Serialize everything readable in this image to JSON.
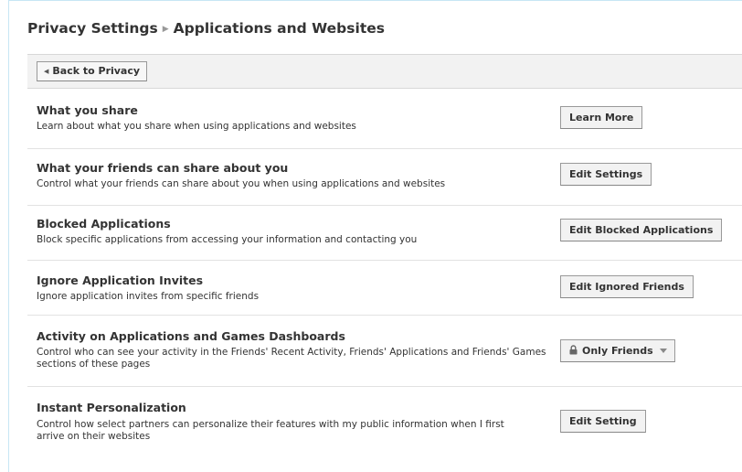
{
  "breadcrumb": {
    "root": "Privacy Settings",
    "current": "Applications and Websites"
  },
  "toolbar": {
    "back_label": "Back to Privacy"
  },
  "sections": [
    {
      "title": "What you share",
      "description": "Learn about what you share when using applications and websites",
      "button": "Learn More"
    },
    {
      "title": "What your friends can share about you",
      "description": "Control what your friends can share about you when using applications and websites",
      "button": "Edit Settings"
    },
    {
      "title": "Blocked Applications",
      "description": "Block specific applications from accessing your information and contacting you",
      "button": "Edit Blocked Applications"
    },
    {
      "title": "Ignore Application Invites",
      "description": "Ignore application invites from specific friends",
      "button": "Edit Ignored Friends"
    },
    {
      "title": "Activity on Applications and Games Dashboards",
      "description": "Control who can see your activity in the Friends' Recent Activity, Friends' Applications and Friends' Games sections of these pages",
      "button": "Only Friends"
    },
    {
      "title": "Instant Personalization",
      "description": "Control how select partners can personalize their features with my public information when I first arrive on their websites",
      "button": "Edit Setting"
    }
  ],
  "icons": {
    "back": "left-arrow-icon",
    "lock": "lock-icon",
    "dropdown": "chevron-down-icon"
  },
  "colors": {
    "frame_border": "#c7e6f4",
    "toolbar_bg": "#f2f2f2",
    "button_bg": "#f2f2f2",
    "text": "#333333"
  }
}
